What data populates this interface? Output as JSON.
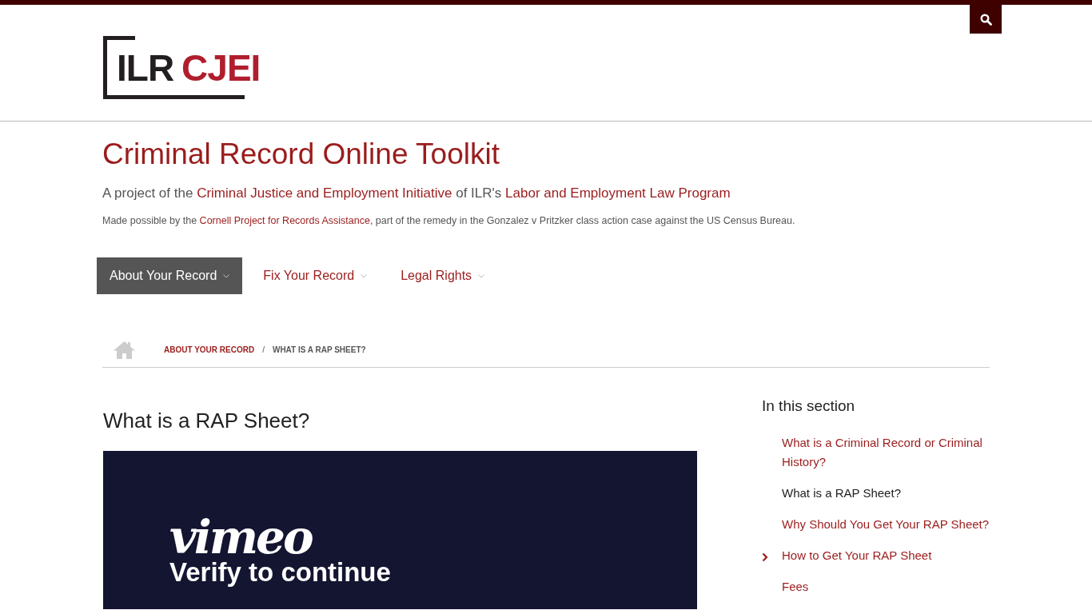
{
  "logo": {
    "part_1": "ILR",
    "part_2": "CJEI"
  },
  "site_title": "Criminal Record Online Toolkit",
  "tagline": {
    "text_1": "A project of the ",
    "link_1": "Criminal Justice and Employment Initiative",
    "text_2": " of ILR's ",
    "link_2": "Labor and Employment Law Program"
  },
  "credit": {
    "text_1": "Made possible by the ",
    "link": "Cornell Project for Records Assistance",
    "text_2": ", part of the remedy in the Gonzalez v Pritzker class action case against the US Census Bureau."
  },
  "nav": [
    {
      "label": "About Your Record",
      "selected": true
    },
    {
      "label": "Fix Your Record",
      "selected": false
    },
    {
      "label": "Legal Rights",
      "selected": false
    }
  ],
  "breadcrumb": [
    {
      "label": "ABOUT YOUR RECORD",
      "kind": "link"
    },
    {
      "label": "/",
      "kind": "separator"
    },
    {
      "label": "WHAT IS A RAP SHEET?",
      "kind": "current"
    }
  ],
  "page_heading": "What is a RAP Sheet?",
  "video": {
    "logo": "vimeo",
    "heading": "Verify to continue"
  },
  "sidebar": {
    "heading": "In this section",
    "items": [
      {
        "label": "What is a Criminal Record or Criminal History?",
        "selected": false,
        "expandable": false
      },
      {
        "label": "What is a RAP Sheet?",
        "selected": true,
        "expandable": false
      },
      {
        "label": "Why Should You Get Your RAP Sheet?",
        "selected": false,
        "expandable": false
      },
      {
        "label": "How to Get Your RAP Sheet",
        "selected": false,
        "expandable": true
      },
      {
        "label": "Fees",
        "selected": false,
        "expandable": false
      }
    ]
  }
}
